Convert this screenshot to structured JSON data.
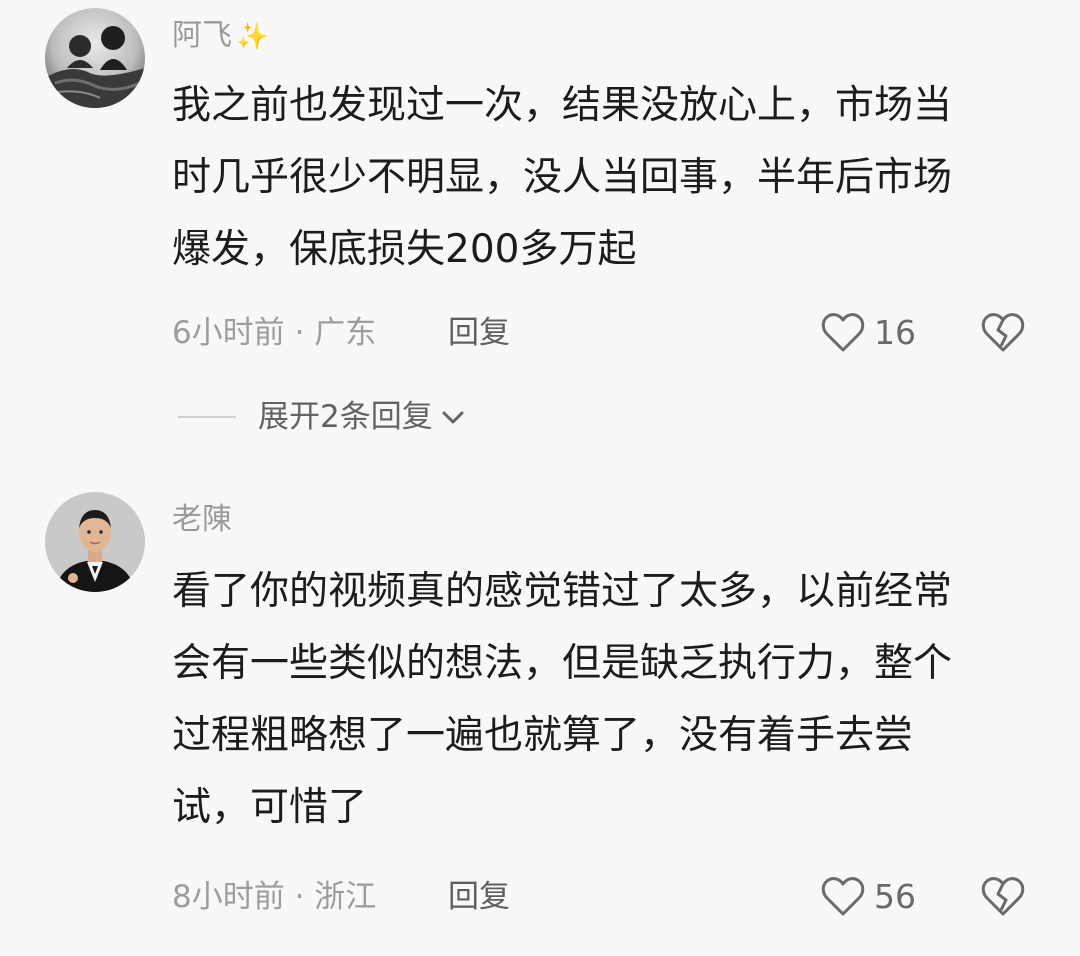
{
  "comments": [
    {
      "username": "阿飞",
      "username_emoji": "✨",
      "lines": [
        "我之前也发现过一次，结果没放心上，市场当",
        "时几乎很少不明显，没人当回事，半年后市场",
        "爆发，保底损失200多万起"
      ],
      "meta": "6小时前 · 广东",
      "reply_label": "回复",
      "likes": "16"
    },
    {
      "username": "老陳",
      "lines": [
        "看了你的视频真的感觉错过了太多，以前经常",
        "会有一些类似的想法，但是缺乏执行力，整个",
        "过程粗略想了一遍也就算了，没有着手去尝",
        "试，可惜了"
      ],
      "meta": "8小时前 · 浙江",
      "reply_label": "回复",
      "likes": "56"
    }
  ],
  "expand_replies": {
    "label": "展开2条回复"
  },
  "icons": {
    "like": "heart-outline-icon",
    "dislike": "broken-heart-icon",
    "expand": "chevron-down-icon"
  },
  "colors": {
    "background": "#f8f8f8",
    "text": "#1c1c1c",
    "muted": "#9d9d9d"
  }
}
